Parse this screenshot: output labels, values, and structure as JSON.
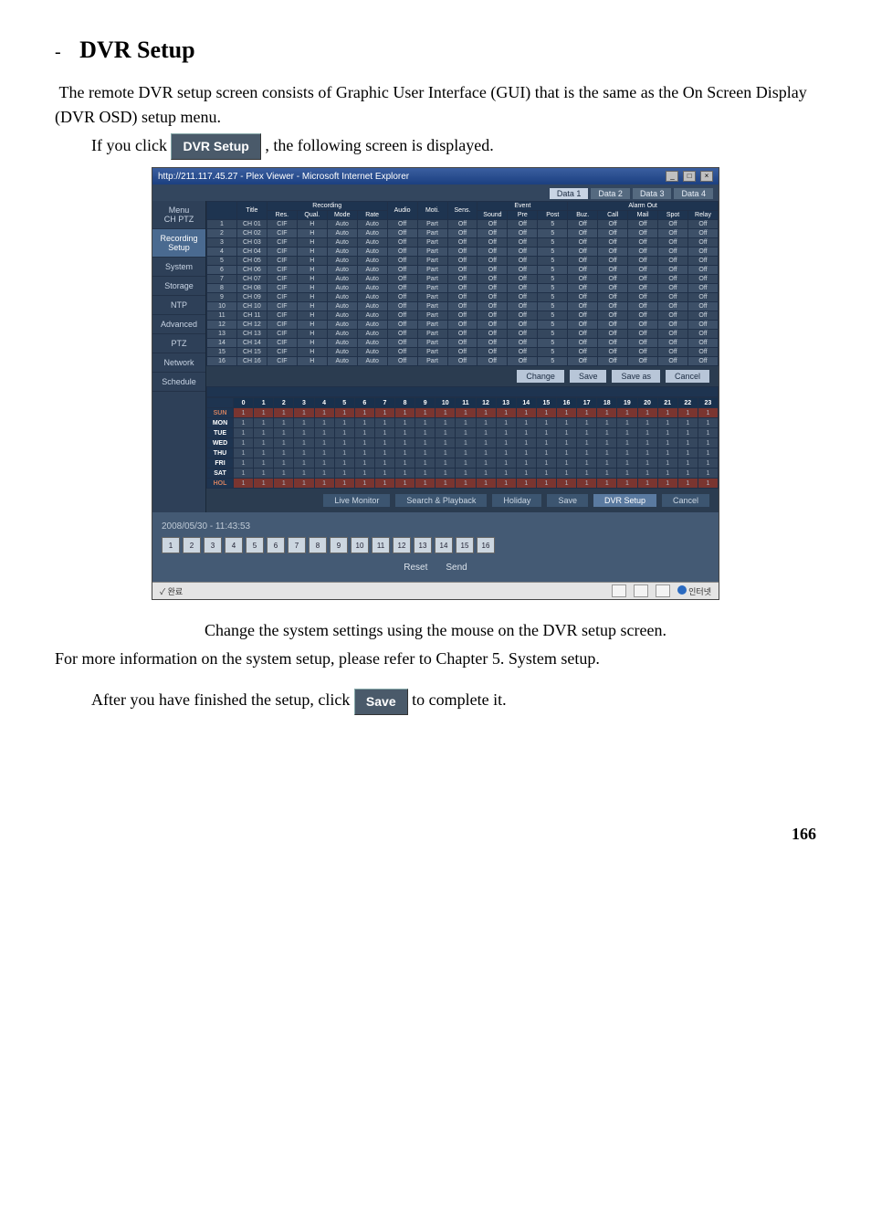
{
  "heading": "DVR Setup",
  "intro_1": "The remote DVR setup screen consists of Graphic User Interface (GUI) that is the same as the On Screen Display (DVR OSD) setup menu.",
  "if_click_before": "If you click",
  "dvr_button": "DVR Setup",
  "if_click_after": ", the following screen is displayed.",
  "browser_title": "http://211.117.45.27 - Plex Viewer - Microsoft Internet Explorer",
  "data_tabs": [
    "Data 1",
    "Data 2",
    "Data 3",
    "Data 4"
  ],
  "side_menu": [
    "Recording Setup",
    "System",
    "Storage",
    "NTP",
    "Advanced",
    "PTZ",
    "Network",
    "Schedule"
  ],
  "menu_col_hdr": [
    "Menu",
    "CH  PTZ"
  ],
  "left_sub": [
    ">",
    "PTZ"
  ],
  "col_groups": [
    "Recording",
    "Event",
    "Alarm Out"
  ],
  "columns": [
    "Title",
    "Res.",
    "Qual.",
    "Mode",
    "Rate",
    "Audio",
    "Moti.",
    "Sens.",
    "Sound",
    "Pre",
    "Post",
    "Buz.",
    "Call",
    "Mail",
    "Spot",
    "Relay"
  ],
  "rows": [
    {
      "n": "1",
      "t": "CH 01",
      "r": "CIF",
      "q": "H",
      "m": "Auto",
      "rt": "Auto",
      "a": "Off",
      "mo": "Part",
      "s": "Off",
      "so": "Off",
      "pr": "Off",
      "po": "5",
      "b": "Off",
      "c": "Off",
      "ma": "Off",
      "sp": "Off",
      "re": "Off"
    },
    {
      "n": "2",
      "t": "CH 02",
      "r": "CIF",
      "q": "H",
      "m": "Auto",
      "rt": "Auto",
      "a": "Off",
      "mo": "Part",
      "s": "Off",
      "so": "Off",
      "pr": "Off",
      "po": "5",
      "b": "Off",
      "c": "Off",
      "ma": "Off",
      "sp": "Off",
      "re": "Off"
    },
    {
      "n": "3",
      "t": "CH 03",
      "r": "CIF",
      "q": "H",
      "m": "Auto",
      "rt": "Auto",
      "a": "Off",
      "mo": "Part",
      "s": "Off",
      "so": "Off",
      "pr": "Off",
      "po": "5",
      "b": "Off",
      "c": "Off",
      "ma": "Off",
      "sp": "Off",
      "re": "Off"
    },
    {
      "n": "4",
      "t": "CH 04",
      "r": "CIF",
      "q": "H",
      "m": "Auto",
      "rt": "Auto",
      "a": "Off",
      "mo": "Part",
      "s": "Off",
      "so": "Off",
      "pr": "Off",
      "po": "5",
      "b": "Off",
      "c": "Off",
      "ma": "Off",
      "sp": "Off",
      "re": "Off"
    },
    {
      "n": "5",
      "t": "CH 05",
      "r": "CIF",
      "q": "H",
      "m": "Auto",
      "rt": "Auto",
      "a": "Off",
      "mo": "Part",
      "s": "Off",
      "so": "Off",
      "pr": "Off",
      "po": "5",
      "b": "Off",
      "c": "Off",
      "ma": "Off",
      "sp": "Off",
      "re": "Off"
    },
    {
      "n": "6",
      "t": "CH 06",
      "r": "CIF",
      "q": "H",
      "m": "Auto",
      "rt": "Auto",
      "a": "Off",
      "mo": "Part",
      "s": "Off",
      "so": "Off",
      "pr": "Off",
      "po": "5",
      "b": "Off",
      "c": "Off",
      "ma": "Off",
      "sp": "Off",
      "re": "Off"
    },
    {
      "n": "7",
      "t": "CH 07",
      "r": "CIF",
      "q": "H",
      "m": "Auto",
      "rt": "Auto",
      "a": "Off",
      "mo": "Part",
      "s": "Off",
      "so": "Off",
      "pr": "Off",
      "po": "5",
      "b": "Off",
      "c": "Off",
      "ma": "Off",
      "sp": "Off",
      "re": "Off"
    },
    {
      "n": "8",
      "t": "CH 08",
      "r": "CIF",
      "q": "H",
      "m": "Auto",
      "rt": "Auto",
      "a": "Off",
      "mo": "Part",
      "s": "Off",
      "so": "Off",
      "pr": "Off",
      "po": "5",
      "b": "Off",
      "c": "Off",
      "ma": "Off",
      "sp": "Off",
      "re": "Off"
    },
    {
      "n": "9",
      "t": "CH 09",
      "r": "CIF",
      "q": "H",
      "m": "Auto",
      "rt": "Auto",
      "a": "Off",
      "mo": "Part",
      "s": "Off",
      "so": "Off",
      "pr": "Off",
      "po": "5",
      "b": "Off",
      "c": "Off",
      "ma": "Off",
      "sp": "Off",
      "re": "Off"
    },
    {
      "n": "10",
      "t": "CH 10",
      "r": "CIF",
      "q": "H",
      "m": "Auto",
      "rt": "Auto",
      "a": "Off",
      "mo": "Part",
      "s": "Off",
      "so": "Off",
      "pr": "Off",
      "po": "5",
      "b": "Off",
      "c": "Off",
      "ma": "Off",
      "sp": "Off",
      "re": "Off"
    },
    {
      "n": "11",
      "t": "CH 11",
      "r": "CIF",
      "q": "H",
      "m": "Auto",
      "rt": "Auto",
      "a": "Off",
      "mo": "Part",
      "s": "Off",
      "so": "Off",
      "pr": "Off",
      "po": "5",
      "b": "Off",
      "c": "Off",
      "ma": "Off",
      "sp": "Off",
      "re": "Off"
    },
    {
      "n": "12",
      "t": "CH 12",
      "r": "CIF",
      "q": "H",
      "m": "Auto",
      "rt": "Auto",
      "a": "Off",
      "mo": "Part",
      "s": "Off",
      "so": "Off",
      "pr": "Off",
      "po": "5",
      "b": "Off",
      "c": "Off",
      "ma": "Off",
      "sp": "Off",
      "re": "Off"
    },
    {
      "n": "13",
      "t": "CH 13",
      "r": "CIF",
      "q": "H",
      "m": "Auto",
      "rt": "Auto",
      "a": "Off",
      "mo": "Part",
      "s": "Off",
      "so": "Off",
      "pr": "Off",
      "po": "5",
      "b": "Off",
      "c": "Off",
      "ma": "Off",
      "sp": "Off",
      "re": "Off"
    },
    {
      "n": "14",
      "t": "CH 14",
      "r": "CIF",
      "q": "H",
      "m": "Auto",
      "rt": "Auto",
      "a": "Off",
      "mo": "Part",
      "s": "Off",
      "so": "Off",
      "pr": "Off",
      "po": "5",
      "b": "Off",
      "c": "Off",
      "ma": "Off",
      "sp": "Off",
      "re": "Off"
    },
    {
      "n": "15",
      "t": "CH 15",
      "r": "CIF",
      "q": "H",
      "m": "Auto",
      "rt": "Auto",
      "a": "Off",
      "mo": "Part",
      "s": "Off",
      "so": "Off",
      "pr": "Off",
      "po": "5",
      "b": "Off",
      "c": "Off",
      "ma": "Off",
      "sp": "Off",
      "re": "Off"
    },
    {
      "n": "16",
      "t": "CH 16",
      "r": "CIF",
      "q": "H",
      "m": "Auto",
      "rt": "Auto",
      "a": "Off",
      "mo": "Part",
      "s": "Off",
      "so": "Off",
      "pr": "Off",
      "po": "5",
      "b": "Off",
      "c": "Off",
      "ma": "Off",
      "sp": "Off",
      "re": "Off"
    }
  ],
  "mid_btns": [
    "Change",
    "Save",
    "Save as",
    "Cancel"
  ],
  "sched_days": [
    "SUN",
    "MON",
    "TUE",
    "WED",
    "THU",
    "FRI",
    "SAT",
    "HOL"
  ],
  "sched_hours": [
    "0",
    "1",
    "2",
    "3",
    "4",
    "5",
    "6",
    "7",
    "8",
    "9",
    "10",
    "11",
    "12",
    "13",
    "14",
    "15",
    "16",
    "17",
    "18",
    "19",
    "20",
    "21",
    "22",
    "23"
  ],
  "bot_btns": [
    "Live Monitor",
    "Search & Playback",
    "Holiday",
    "Save",
    "DVR Setup",
    "Cancel"
  ],
  "timestamp": "2008/05/30 - 11:43:53",
  "ch_nums": [
    "1",
    "2",
    "3",
    "4",
    "5",
    "6",
    "7",
    "8",
    "9",
    "10",
    "11",
    "12",
    "13",
    "14",
    "15",
    "16"
  ],
  "reset": "Reset",
  "send": "Send",
  "status_left": "완료",
  "status_right": "인터넷",
  "after_img_1": "Change the system settings using the mouse on the DVR setup screen.",
  "after_img_2": "For more information on the system setup, please refer to Chapter 5. System setup.",
  "finish_before": "After you have finished the setup, click",
  "save_btn": "Save",
  "finish_after": " to complete it.",
  "page_number": "166"
}
